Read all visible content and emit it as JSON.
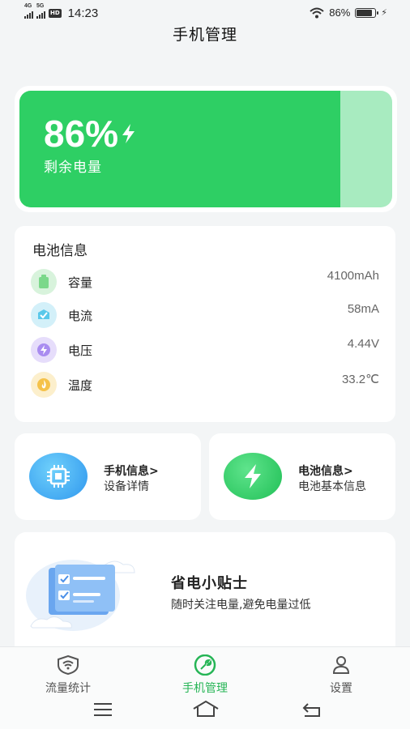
{
  "status_bar": {
    "sim1": "4G",
    "sim2": "5G",
    "hd": "HD",
    "time": "14:23",
    "battery_percent_text": "86%",
    "battery_level": 0.86
  },
  "header": {
    "title": "手机管理"
  },
  "battery": {
    "percent_text": "86%",
    "label": "剩余电量",
    "level": 0.86,
    "fill_color": "#2ecf64",
    "track_color": "#a8ebc0"
  },
  "battery_info": {
    "title": "电池信息",
    "rows": [
      {
        "label": "容量",
        "value": "4100mAh",
        "icon": "battery-capacity-icon",
        "color": "#7bd88a"
      },
      {
        "label": "电流",
        "value": "58mA",
        "icon": "current-icon",
        "color": "#5ac8ea"
      },
      {
        "label": "电压",
        "value": "4.44V",
        "icon": "voltage-bolt-icon",
        "color": "#a98cf0"
      },
      {
        "label": "温度",
        "value": "33.2℃",
        "icon": "temperature-flame-icon",
        "color": "#f5c24a"
      }
    ]
  },
  "cards": {
    "phone_info": {
      "title": "手机信息>",
      "subtitle": "设备详情",
      "icon": "chip-icon",
      "color": "#3aa5f2"
    },
    "battery_info": {
      "title": "电池信息>",
      "subtitle": "电池基本信息",
      "icon": "bolt-icon",
      "color": "#2ecf64"
    }
  },
  "tips": {
    "title": "省电小贴士",
    "subtitle": "随时关注电量,避免电量过低",
    "icon": "checklist-illustration-icon"
  },
  "bottom_nav": {
    "items": [
      {
        "label": "流量统计",
        "icon": "wifi-shield-icon",
        "active": false
      },
      {
        "label": "手机管理",
        "icon": "wrench-icon",
        "active": true
      },
      {
        "label": "设置",
        "icon": "user-icon",
        "active": false
      }
    ],
    "active_color": "#26b556"
  }
}
